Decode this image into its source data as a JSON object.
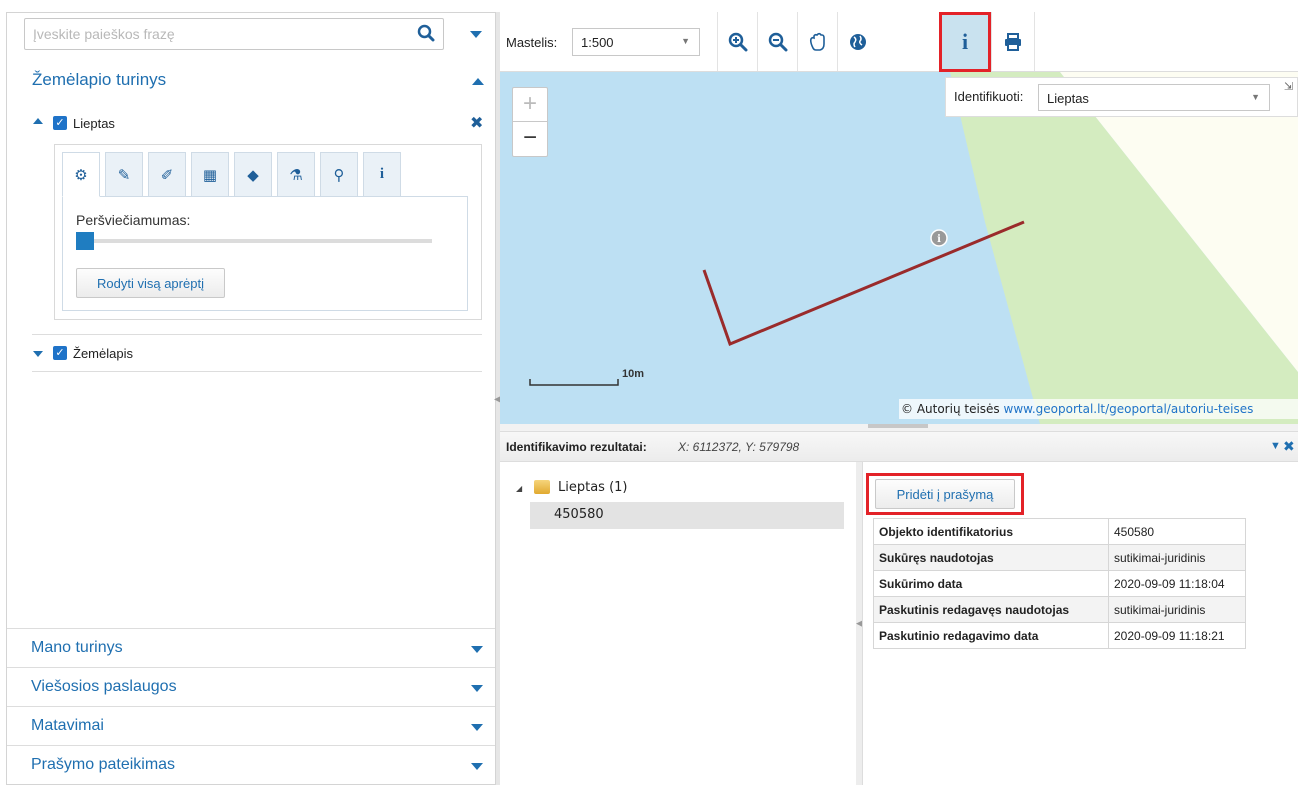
{
  "search": {
    "placeholder": "Įveskite paieškos frazę"
  },
  "sidebar": {
    "map_content_title": "Žemėlapio turinys",
    "layers": [
      {
        "name": "Lieptas",
        "checked": true,
        "expanded": true
      },
      {
        "name": "Žemėlapis",
        "checked": true,
        "expanded": false
      }
    ],
    "layer_tabs": [
      "settings-icon",
      "pencil-icon",
      "eyedropper-icon",
      "table-icon",
      "tag-icon",
      "flask-icon",
      "search-icon",
      "info-icon"
    ],
    "transparency_label": "Peršviečiamumas:",
    "transparency_value": 0,
    "show_extent_button": "Rodyti visą aprėptį",
    "sections": [
      "Mano turinys",
      "Viešosios paslaugos",
      "Matavimai",
      "Prašymo pateikimas"
    ]
  },
  "toolbar": {
    "scale_label": "Mastelis:",
    "scale_value": "1:500",
    "tools": [
      "zoom-in-icon",
      "zoom-out-icon",
      "pan-hand-icon",
      "globe-icon",
      "info-icon",
      "print-icon"
    ],
    "active_tool": "info-icon"
  },
  "map": {
    "identify_label": "Identifikuoti:",
    "identify_value": "Lieptas",
    "zoom_in": "+",
    "zoom_out": "−",
    "scale_bar_label": "10m",
    "copyright_prefix": "© Autorių teisės",
    "copyright_link": "www.geoportal.lt/geoportal/autoriu-teises",
    "colors": {
      "water": "#bde0f3",
      "grass": "#d4ecc0",
      "land": "#fdfdf2",
      "feature": "#9a2b2b"
    }
  },
  "results": {
    "title": "Identifikavimo rezultatai:",
    "coords": "X: 6112372, Y: 579798",
    "tree_layer": "Lieptas (1)",
    "tree_item": "450580",
    "add_button": "Pridėti į prašymą",
    "attributes": [
      {
        "key": "Objekto identifikatorius",
        "value": "450580"
      },
      {
        "key": "Sukūręs naudotojas",
        "value": "sutikimai-juridinis"
      },
      {
        "key": "Sukūrimo data",
        "value": "2020-09-09 11:18:04"
      },
      {
        "key": "Paskutinis redagavęs naudotojas",
        "value": "sutikimai-juridinis"
      },
      {
        "key": "Paskutinio redagavimo data",
        "value": "2020-09-09 11:18:21"
      }
    ]
  }
}
